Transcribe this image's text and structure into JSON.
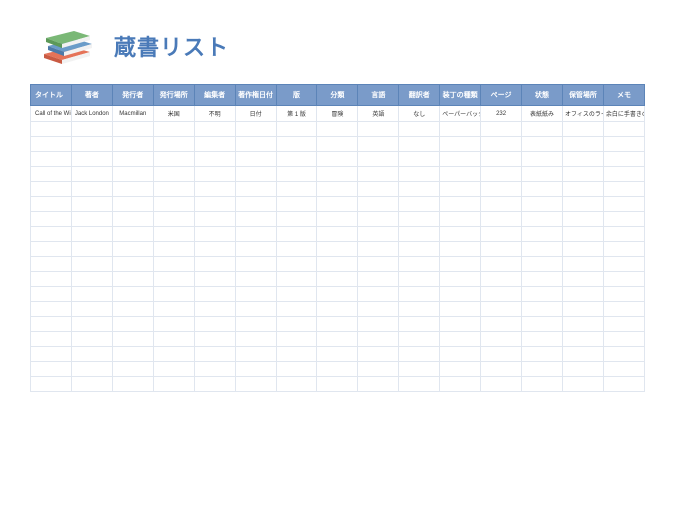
{
  "header": {
    "title": "蔵書リスト"
  },
  "table": {
    "columns": [
      "タイトル",
      "著者",
      "発行者",
      "発行場所",
      "編集者",
      "著作権日付",
      "版",
      "分類",
      "言語",
      "翻訳者",
      "装丁の種類",
      "ページ",
      "状態",
      "保管場所",
      "メモ"
    ],
    "rows": [
      {
        "cells": [
          "Call of the Wild",
          "Jack London",
          "Macmillan",
          "米国",
          "不明",
          "日付",
          "第 1 版",
          "冒険",
          "英語",
          "なし",
          "ペーパーバック",
          "232",
          "表紙紙み",
          "オフィスのライブラリ",
          "余白に手書きのメモ"
        ]
      }
    ],
    "emptyRows": 18
  },
  "colors": {
    "header_bg": "#7a9bc9",
    "header_border": "#5c84b8",
    "title_color": "#4a7ab8",
    "cell_border": "#e0e6ef",
    "memo_text": "#c0504d"
  }
}
